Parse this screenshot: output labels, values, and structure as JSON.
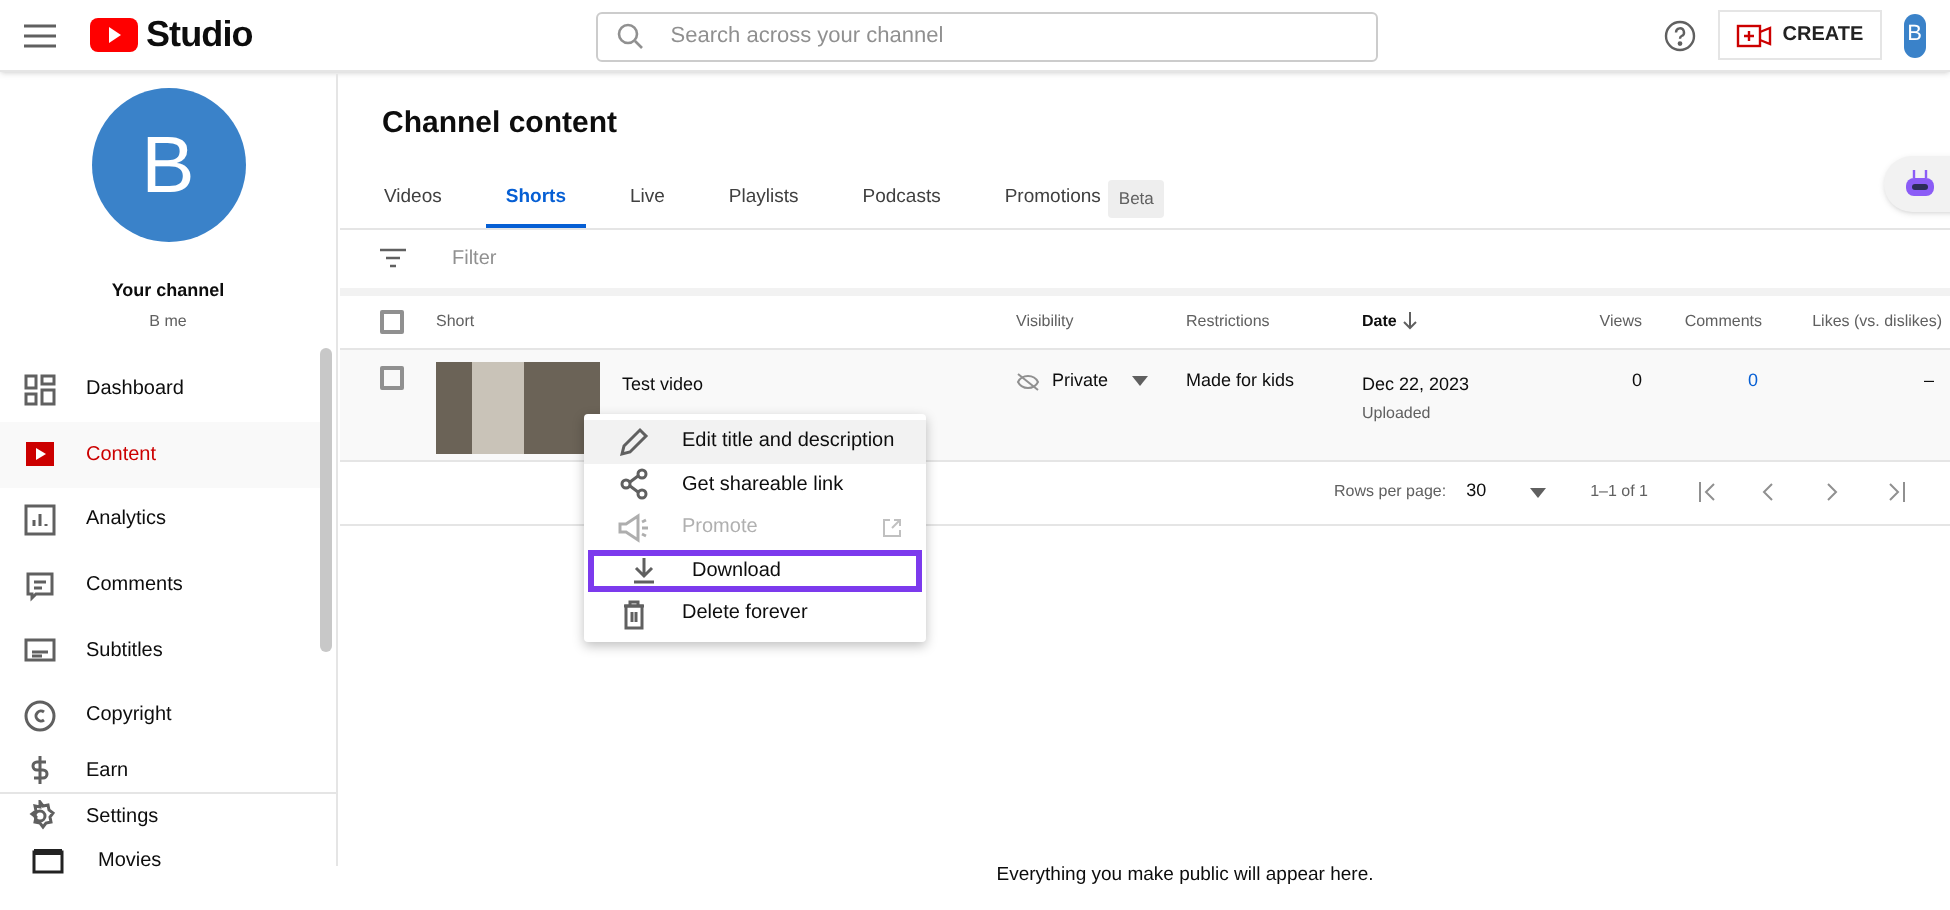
{
  "header": {
    "logo_text": "Studio",
    "search": {
      "placeholder": "Search across your channel"
    },
    "create_button": "CREATE",
    "avatar_letter": "B"
  },
  "sidebar": {
    "avatar_letter": "B",
    "channel_title": "Your channel",
    "channel_name": "B me",
    "items": [
      {
        "label": "Dashboard",
        "kind": "dashboard",
        "selected": false
      },
      {
        "label": "Content",
        "kind": "content",
        "selected": true
      },
      {
        "label": "Analytics",
        "kind": "analytics",
        "selected": false
      },
      {
        "label": "Comments",
        "kind": "comments",
        "selected": false
      },
      {
        "label": "Subtitles",
        "kind": "subtitles",
        "selected": false
      },
      {
        "label": "Copyright",
        "kind": "copyright",
        "selected": false
      },
      {
        "label": "Earn",
        "kind": "earn",
        "selected": false
      }
    ],
    "bottom_items": [
      {
        "label": "Settings",
        "kind": "settings"
      },
      {
        "label": "Movies",
        "kind": "clapper"
      }
    ]
  },
  "page": {
    "title": "Channel content",
    "tabs": [
      {
        "label": "Videos",
        "selected": false
      },
      {
        "label": "Shorts",
        "selected": true
      },
      {
        "label": "Live",
        "selected": false
      },
      {
        "label": "Playlists",
        "selected": false
      },
      {
        "label": "Podcasts",
        "selected": false
      },
      {
        "label": "Promotions",
        "selected": false,
        "badge": "Beta"
      }
    ],
    "filter": {
      "placeholder": "Filter"
    },
    "table": {
      "select_all_checked": false,
      "columns": [
        "Short",
        "Visibility",
        "Restrictions",
        "Date",
        "Views",
        "Comments",
        "Likes (vs. dislikes)"
      ],
      "rows": [
        {
          "checked": false,
          "title": "Test video",
          "visibility": "Private",
          "restrictions": "Made for kids",
          "date": "Dec 22, 2023",
          "date_status": "Uploaded",
          "views": "0",
          "comments": "0",
          "likes": "–"
        }
      ]
    },
    "pagination": {
      "rows_per_page_label": "Rows per page:",
      "rows_per_page": "30",
      "range": "1–1 of 1"
    },
    "context_menu": [
      {
        "label": "Edit title and description",
        "kind": "pencil",
        "disabled": false,
        "highlighted": false
      },
      {
        "label": "Get shareable link",
        "kind": "share",
        "disabled": false,
        "highlighted": false
      },
      {
        "label": "Promote",
        "kind": "megaphone",
        "disabled": true,
        "highlighted": false
      },
      {
        "label": "Download",
        "kind": "download",
        "disabled": false,
        "highlighted": true
      },
      {
        "label": "Delete forever",
        "kind": "trash",
        "disabled": false,
        "highlighted": false
      }
    ],
    "empty_message": "Everything you make public will appear here."
  }
}
